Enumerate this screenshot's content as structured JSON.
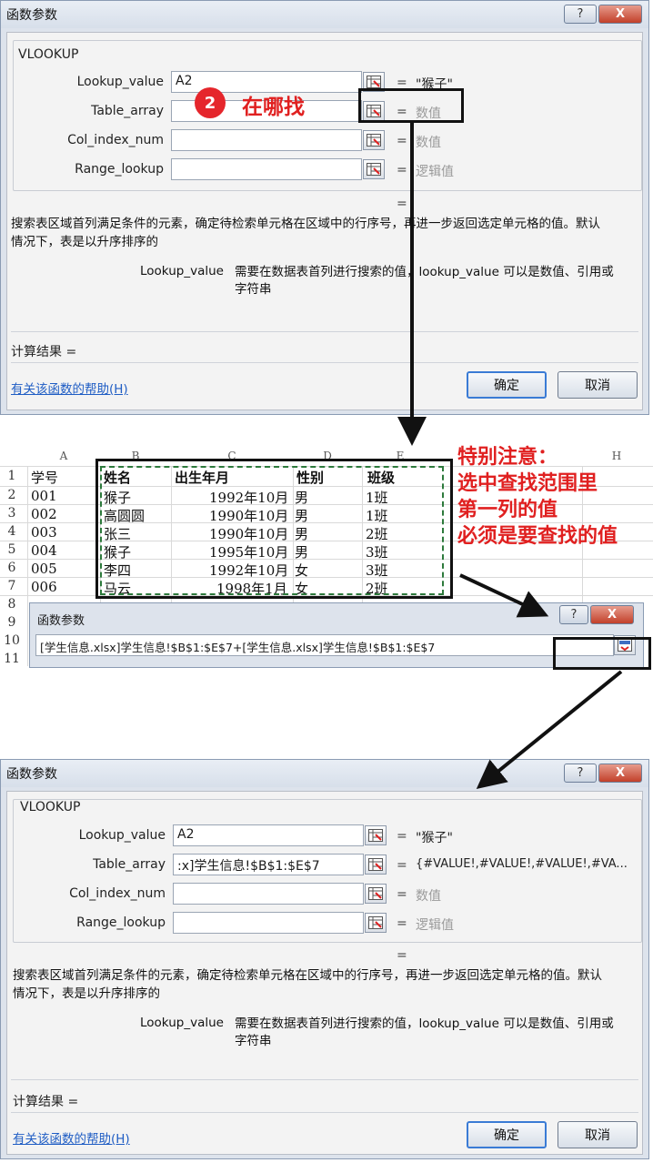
{
  "dialog1": {
    "title": "函数参数",
    "help_btn": "?",
    "close_btn": "X",
    "function_name": "VLOOKUP",
    "args": [
      {
        "label": "Lookup_value",
        "value": "A2",
        "result": "\"猴子\"",
        "gray": false
      },
      {
        "label": "Table_array",
        "value": "",
        "result": "数值",
        "gray": true
      },
      {
        "label": "Col_index_num",
        "value": "",
        "result": "数值",
        "gray": true
      },
      {
        "label": "Range_lookup",
        "value": "",
        "result": "逻辑值",
        "gray": true
      }
    ],
    "eq": "=",
    "result_eq": "=",
    "description_line1": "搜索表区域首列满足条件的元素，确定待检索单元格在区域中的行序号，再进一步返回选定单元格的值。默认",
    "description_line2": "情况下，表是以升序排序的",
    "arg_desc_name": "Lookup_value",
    "arg_desc_line1": "需要在数据表首列进行搜索的值，lookup_value 可以是数值、引用或",
    "arg_desc_line2": "字符串",
    "calc_result": "计算结果 =",
    "help_link": "有关该函数的帮助(H)",
    "ok": "确定",
    "cancel": "取消"
  },
  "annotation_step": "2",
  "annotation_where": "在哪找",
  "annotation_note": [
    "特别注意：",
    "选中查找范围里",
    "第一列的值",
    "必须是要查找的值"
  ],
  "sheet": {
    "columns": [
      "A",
      "B",
      "C",
      "D",
      "E",
      "H"
    ],
    "row_numbers": [
      "1",
      "2",
      "3",
      "4",
      "5",
      "6",
      "7",
      "8",
      "9",
      "10",
      "11"
    ],
    "header": [
      "学号",
      "姓名",
      "出生年月",
      "性别",
      "班级"
    ],
    "rows": [
      [
        "001",
        "猴子",
        "1992年10月",
        "男",
        "1班"
      ],
      [
        "002",
        "高圆圆",
        "1990年10月",
        "男",
        "1班"
      ],
      [
        "003",
        "张三",
        "1990年10月",
        "男",
        "2班"
      ],
      [
        "004",
        "猴子",
        "1995年10月",
        "男",
        "3班"
      ],
      [
        "005",
        "李四",
        "1992年10月",
        "女",
        "3班"
      ],
      [
        "006",
        "马云",
        "1998年1月",
        "女",
        "2班"
      ]
    ]
  },
  "mini_dialog": {
    "title": "函数参数",
    "help_btn": "?",
    "close_btn": "X",
    "formula": "[学生信息.xlsx]学生信息!$B$1:$E$7+[学生信息.xlsx]学生信息!$B$1:$E$7"
  },
  "dialog2": {
    "title": "函数参数",
    "help_btn": "?",
    "close_btn": "X",
    "function_name": "VLOOKUP",
    "args": [
      {
        "label": "Lookup_value",
        "value": "A2",
        "result": "\"猴子\"",
        "gray": false
      },
      {
        "label": "Table_array",
        "value": ":x]学生信息!$B$1:$E$7",
        "result": "{#VALUE!,#VALUE!,#VALUE!,#VA...",
        "gray": false
      },
      {
        "label": "Col_index_num",
        "value": "",
        "result": "数值",
        "gray": true
      },
      {
        "label": "Range_lookup",
        "value": "",
        "result": "逻辑值",
        "gray": true
      }
    ],
    "eq": "=",
    "result_eq": "=",
    "description_line1": "搜索表区域首列满足条件的元素，确定待检索单元格在区域中的行序号，再进一步返回选定单元格的值。默认",
    "description_line2": "情况下，表是以升序排序的",
    "arg_desc_name": "Lookup_value",
    "arg_desc_line1": "需要在数据表首列进行搜索的值，lookup_value 可以是数值、引用或",
    "arg_desc_line2": "字符串",
    "calc_result": "计算结果 =",
    "help_link": "有关该函数的帮助(H)",
    "ok": "确定",
    "cancel": "取消"
  }
}
